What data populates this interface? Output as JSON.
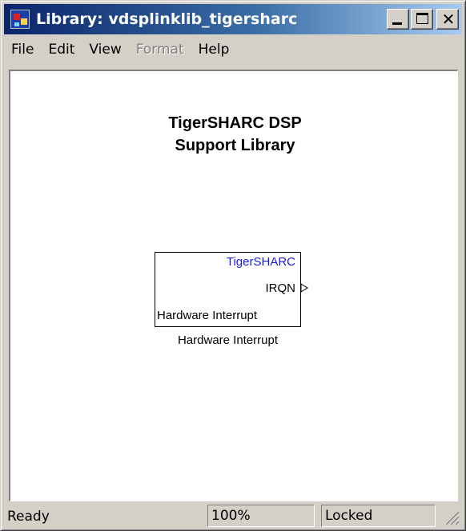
{
  "window": {
    "title": "Library: vdsplinklib_tigersharc",
    "app_icon": "simulink-library-icon",
    "controls": [
      "minimize",
      "maximize",
      "close"
    ]
  },
  "menu": {
    "items": [
      {
        "label": "File",
        "enabled": true
      },
      {
        "label": "Edit",
        "enabled": true
      },
      {
        "label": "View",
        "enabled": true
      },
      {
        "label": "Format",
        "enabled": false
      },
      {
        "label": "Help",
        "enabled": true
      }
    ]
  },
  "canvas": {
    "library_title_line1": "TigerSHARC DSP",
    "library_title_line2": "Support Library",
    "block": {
      "family_label": "TigerSHARC",
      "output_port": "IRQN",
      "inner_label": "Hardware Interrupt",
      "caption": "Hardware Interrupt",
      "family_color": "#1a1adc"
    }
  },
  "status": {
    "state": "Ready",
    "zoom": "100%",
    "lock": "Locked"
  },
  "colors": {
    "titlebar_start": "#0a246a",
    "titlebar_end": "#a6caf0",
    "chrome": "#d4d0c8"
  }
}
